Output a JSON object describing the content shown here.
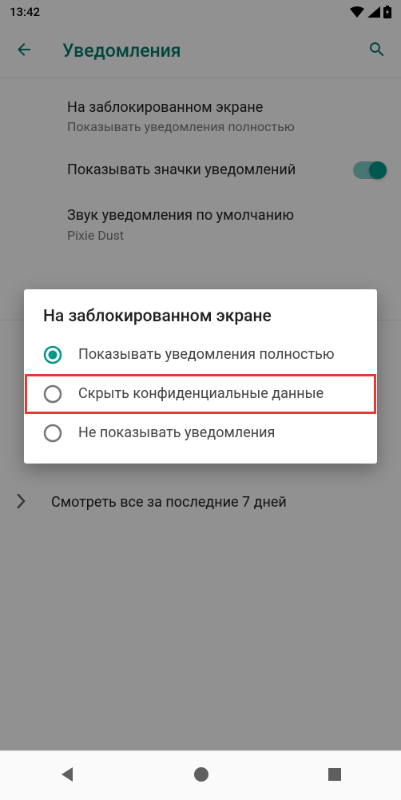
{
  "status": {
    "time": "13:42"
  },
  "header": {
    "title": "Уведомления"
  },
  "settings": {
    "lock_screen": {
      "title": "На заблокированном экране",
      "subtitle": "Показывать уведомления полностью"
    },
    "badges": {
      "title": "Показывать значки уведомлений"
    },
    "sound": {
      "title": "Звук уведомления по умолчанию",
      "subtitle": "Pixie Dust"
    },
    "recent": {
      "label": "Смотреть все за последние 7 дней"
    }
  },
  "dialog": {
    "title": "На заблокированном экране",
    "options": [
      {
        "label": "Показывать уведомления полностью",
        "selected": true
      },
      {
        "label": "Скрыть конфиденциальные данные",
        "selected": false
      },
      {
        "label": "Не показывать уведомления",
        "selected": false
      }
    ]
  },
  "colors": {
    "accent": "#009688",
    "highlight": "#e53935"
  }
}
